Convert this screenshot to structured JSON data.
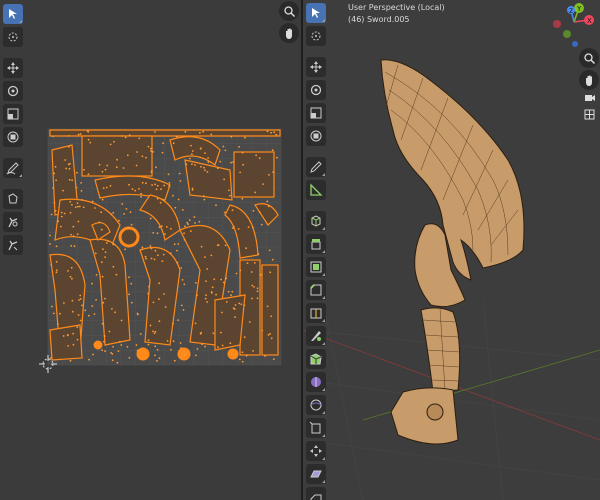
{
  "uv_editor": {
    "tools": [
      {
        "name": "select-tool",
        "icon": "cursor-icon",
        "active": true
      },
      {
        "name": "cursor-tool",
        "icon": "crosshair-circle-icon",
        "active": false
      },
      {
        "name": "move-tool",
        "icon": "move-arrows-icon",
        "active": false
      },
      {
        "name": "rotate-tool",
        "icon": "rotate-icon",
        "active": false
      },
      {
        "name": "scale-tool",
        "icon": "scale-icon",
        "active": false
      },
      {
        "name": "transform-tool",
        "icon": "transform-icon",
        "active": false
      },
      {
        "name": "annotate-tool",
        "icon": "pencil-icon",
        "active": false
      },
      {
        "name": "grab-tool",
        "icon": "grab-brush-icon",
        "active": false
      },
      {
        "name": "relax-tool",
        "icon": "relax-icon",
        "active": false
      },
      {
        "name": "pinch-tool",
        "icon": "pinch-icon",
        "active": false
      }
    ],
    "nav": [
      "zoom-icon",
      "hand-icon"
    ]
  },
  "viewport": {
    "view_name": "User Perspective (Local)",
    "object_label": "(46) Sword.005",
    "gizmo_axes": {
      "x": "X",
      "y": "Y",
      "z": "Z"
    },
    "colors": {
      "x": "#f0465e",
      "y": "#80c01f",
      "z": "#4a8cf0",
      "mesh": "#c79b6a",
      "wire": "#2e1f10"
    },
    "tools": [
      "select-tool",
      "cursor-tool",
      "move-tool",
      "rotate-tool",
      "scale-tool",
      "transform-tool",
      "annotate-tool",
      "measure-tool",
      "add-cube-tool",
      "extrude-tool",
      "inset-tool",
      "bevel-tool",
      "loop-cut-tool",
      "knife-tool",
      "poly-build-tool",
      "spin-tool",
      "smooth-tool",
      "edge-slide-tool",
      "shrink-fatten-tool",
      "shear-tool",
      "rip-tool"
    ],
    "nav": [
      "zoom-icon",
      "hand-icon",
      "camera-icon",
      "grid-icon"
    ]
  }
}
